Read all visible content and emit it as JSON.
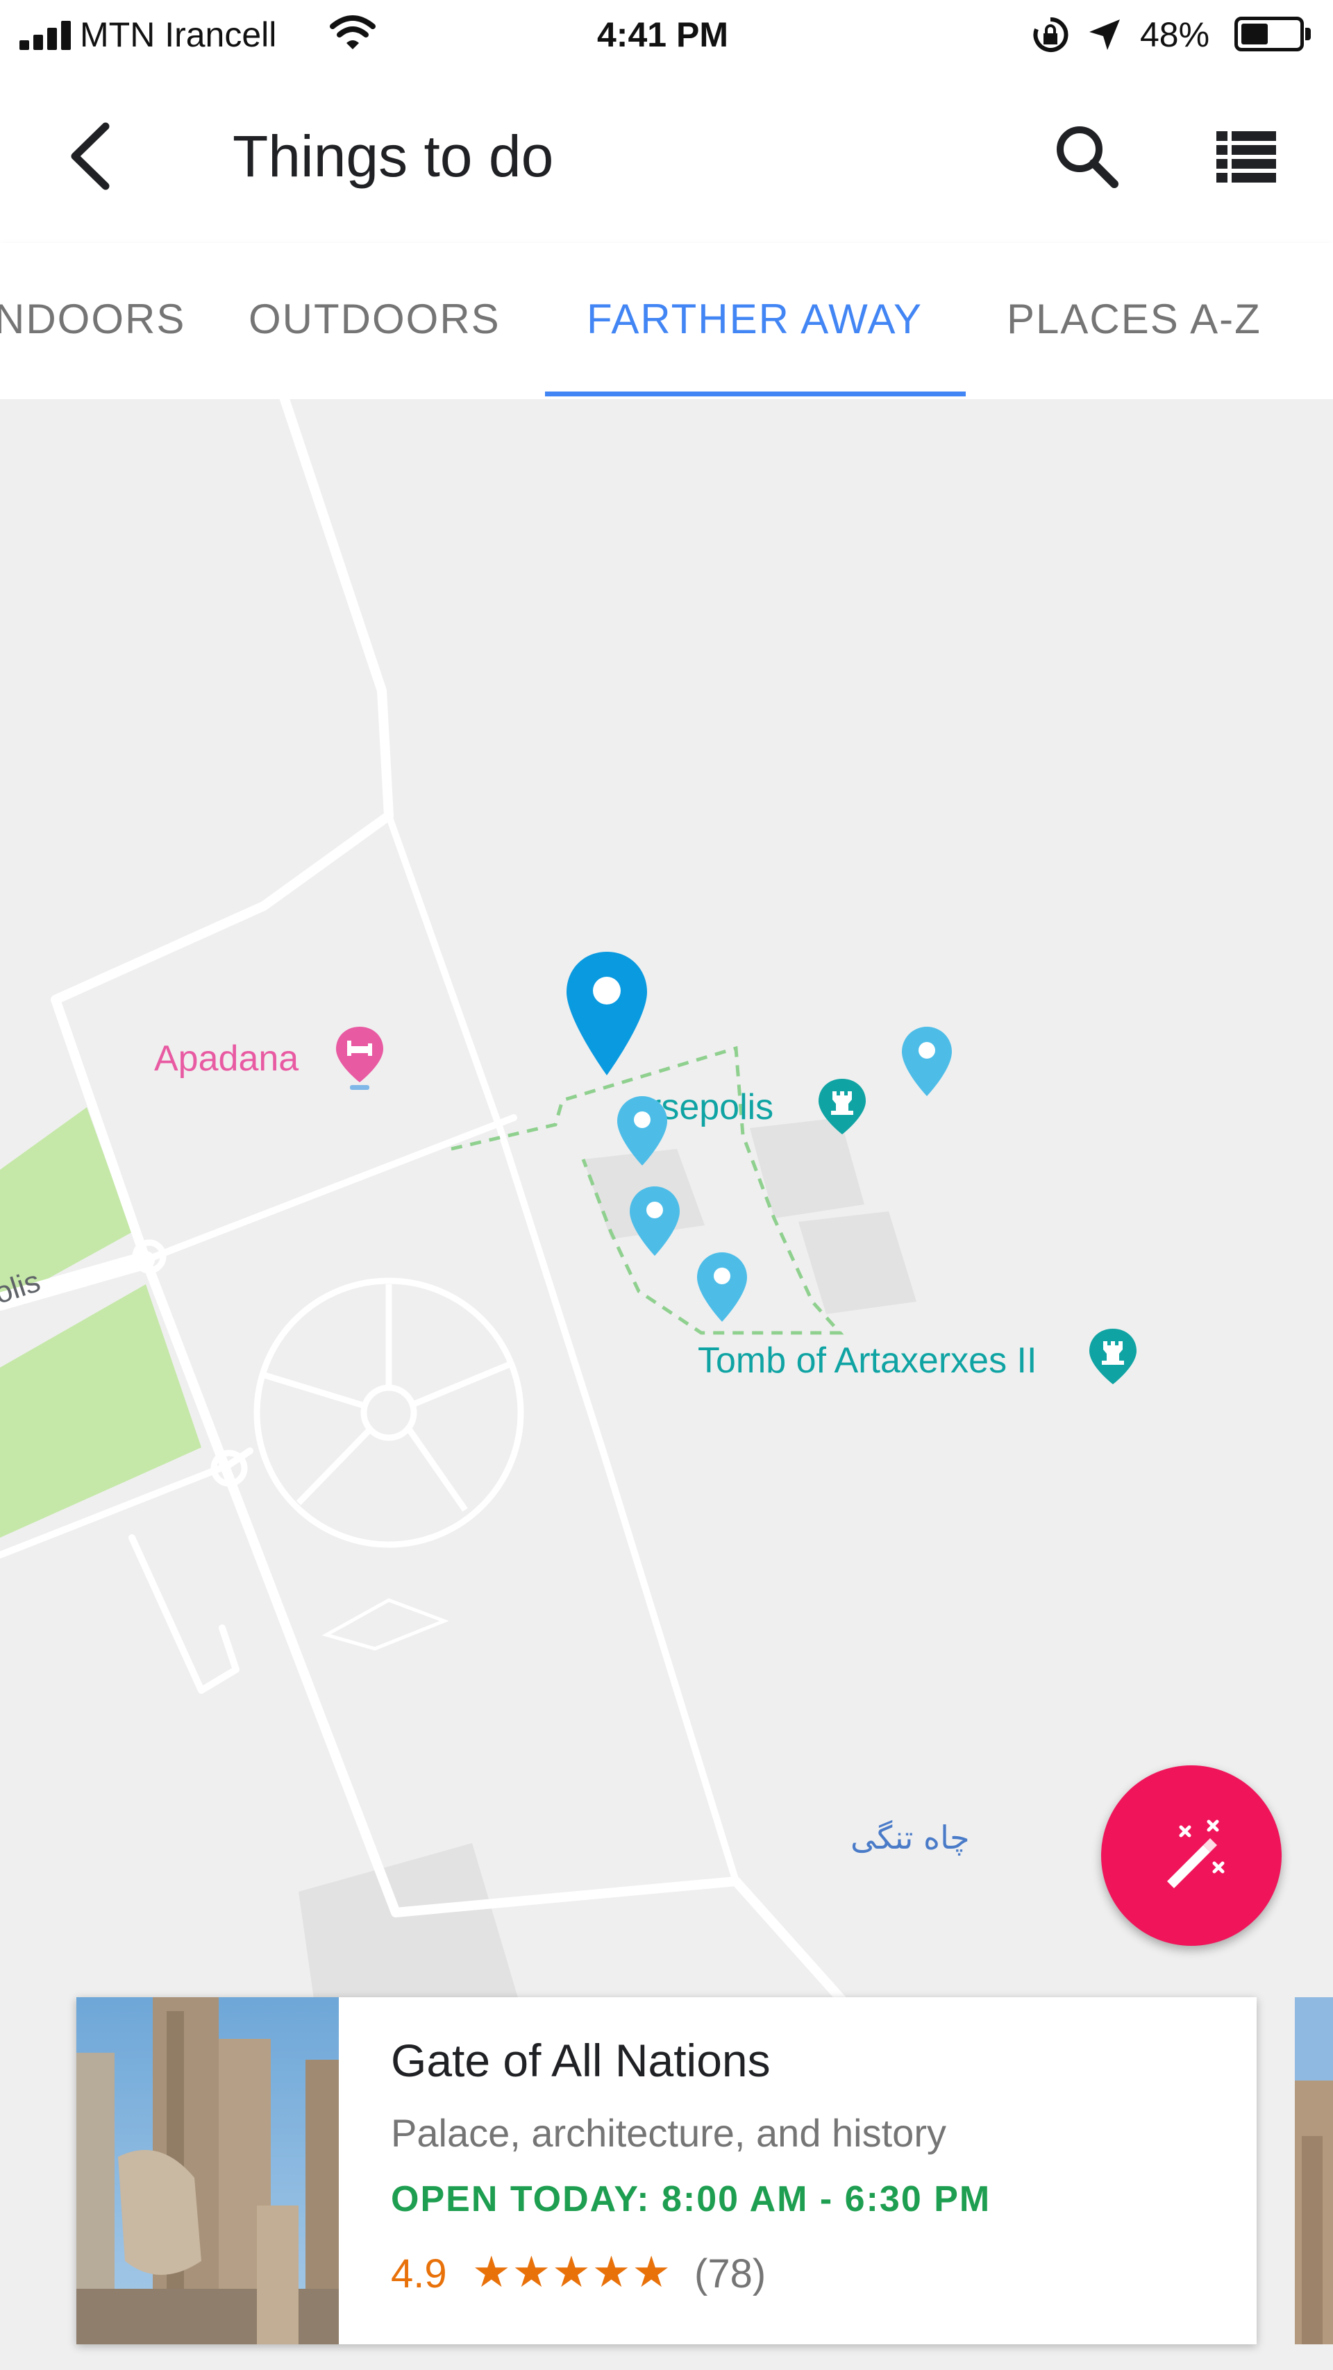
{
  "status_bar": {
    "carrier": "MTN Irancell",
    "time": "4:41 PM",
    "battery": "48%",
    "battery_level": 0.48
  },
  "header": {
    "title": "Things to do"
  },
  "tabs": [
    {
      "label": "NDOORS",
      "active": false
    },
    {
      "label": "OUTDOORS",
      "active": false
    },
    {
      "label": "FARTHER AWAY",
      "active": true
    },
    {
      "label": "PLACES A-Z",
      "active": false
    }
  ],
  "map": {
    "labels": {
      "apadana": "Apadana",
      "persepolis": "rsepolis",
      "tomb": "Tomb of Artaxerxes II",
      "road": "olis",
      "village": "چاه تنگی"
    },
    "colors": {
      "pink": "#e85aa2",
      "teal": "#0fa3a3",
      "pin_blue": "#0a9ae0",
      "pin_light": "#4dbde8",
      "park": "#c5e8a8",
      "road": "#ffffff"
    }
  },
  "place_card": {
    "name": "Gate of All Nations",
    "category": "Palace, architecture, and history",
    "hours": "OPEN TODAY: 8:00 AM - 6:30 PM",
    "rating": "4.9",
    "rating_value": 4.9,
    "stars": "★★★★★",
    "review_count": "(78)"
  },
  "icons": {
    "back": "arrow-back-icon",
    "search": "search-icon",
    "list": "list-view-icon",
    "fab": "magic-wand-icon"
  }
}
